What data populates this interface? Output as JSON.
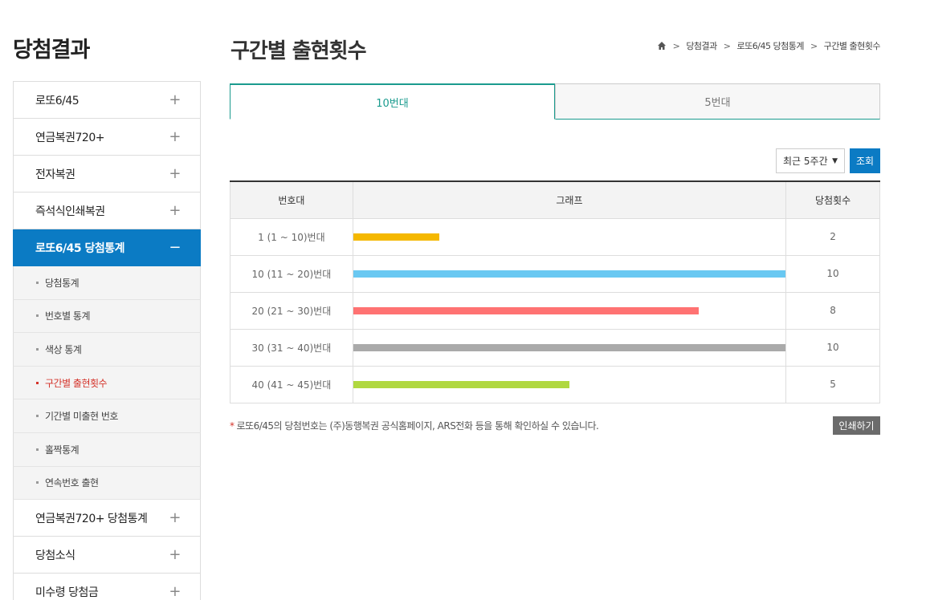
{
  "sidebar": {
    "title": "당첨결과",
    "items_top": [
      {
        "label": "로또6/45",
        "icon": "+"
      },
      {
        "label": "연금복권720+",
        "icon": "+"
      },
      {
        "label": "전자복권",
        "icon": "+"
      },
      {
        "label": "즉석식인쇄복권",
        "icon": "+"
      }
    ],
    "active": {
      "label": "로또6/45 당첨통계",
      "icon": "−"
    },
    "sub_items": [
      {
        "label": "당첨통계"
      },
      {
        "label": "번호별 통계"
      },
      {
        "label": "색상 통계"
      },
      {
        "label": "구간별 출현횟수"
      },
      {
        "label": "기간별 미출현 번호"
      },
      {
        "label": "홀짝통계"
      },
      {
        "label": "연속번호 출현"
      }
    ],
    "items_bottom": [
      {
        "label": "연금복권720+ 당첨통계",
        "icon": "+"
      },
      {
        "label": "당첨소식",
        "icon": "+"
      },
      {
        "label": "미수령 당첨금",
        "icon": "+"
      }
    ]
  },
  "header": {
    "title": "구간별 출현횟수",
    "breadcrumb": [
      "당첨결과",
      "로또6/45 당첨통계",
      "구간별 출현횟수"
    ],
    "separator": ">"
  },
  "tabs": [
    {
      "label": "10번대",
      "active": true
    },
    {
      "label": "5번대",
      "active": false
    }
  ],
  "filter": {
    "period_selected": "최근 5주간",
    "caret": "▼",
    "search_label": "조회"
  },
  "table": {
    "headers": [
      "번호대",
      "그래프",
      "당첨횟수"
    ],
    "max_count": 10,
    "rows": [
      {
        "range": "1 (1 ~ 10)번대",
        "count": 2,
        "color": "#f5b800"
      },
      {
        "range": "10 (11 ~ 20)번대",
        "count": 10,
        "color": "#69c8f2"
      },
      {
        "range": "20 (21 ~ 30)번대",
        "count": 8,
        "color": "#ff7272"
      },
      {
        "range": "30 (31 ~ 40)번대",
        "count": 10,
        "color": "#aaaaaa"
      },
      {
        "range": "40 (41 ~ 45)번대",
        "count": 5,
        "color": "#b0d840"
      }
    ]
  },
  "footnote": {
    "star": "*",
    "text": "로또6/45의 당첨번호는 (주)동행복권 공식홈페이지, ARS전화 등을 통해 확인하실 수 있습니다."
  },
  "print_label": "인쇄하기",
  "chart_data": {
    "type": "bar",
    "categories": [
      "1 (1 ~ 10)번대",
      "10 (11 ~ 20)번대",
      "20 (21 ~ 30)번대",
      "30 (31 ~ 40)번대",
      "40 (41 ~ 45)번대"
    ],
    "values": [
      2,
      10,
      8,
      10,
      5
    ],
    "title": "",
    "xlabel": "",
    "ylabel": "",
    "ylim": [
      0,
      10
    ]
  }
}
